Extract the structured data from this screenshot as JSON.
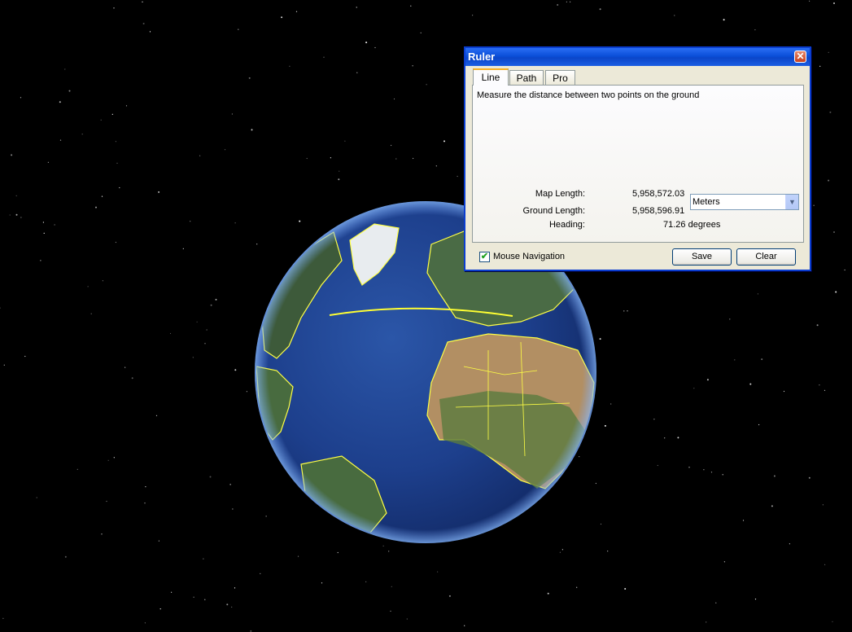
{
  "ruler": {
    "title": "Ruler",
    "close_glyph": "✕",
    "tabs": [
      {
        "label": "Line",
        "active": true
      },
      {
        "label": "Path",
        "active": false
      },
      {
        "label": "Pro",
        "active": false
      }
    ],
    "description": "Measure the distance between two points on the ground",
    "map_length_label": "Map Length:",
    "map_length_value": "5,958,572.03",
    "unit_selected": "Meters",
    "ground_length_label": "Ground Length:",
    "ground_length_value": "5,958,596.91",
    "heading_label": "Heading:",
    "heading_value": "71.26 degrees",
    "mouse_navigation_label": "Mouse Navigation",
    "mouse_navigation_checked": true,
    "save_label": "Save",
    "clear_label": "Clear"
  },
  "icons": {
    "close": "close-icon",
    "dropdown": "chevron-down-icon",
    "check": "checkmark-icon"
  },
  "colors": {
    "border_lines": "#ffff44",
    "measure_line": "#ffff33",
    "ocean": "#1f3f8e",
    "titlebar": "#0a4fd8"
  }
}
